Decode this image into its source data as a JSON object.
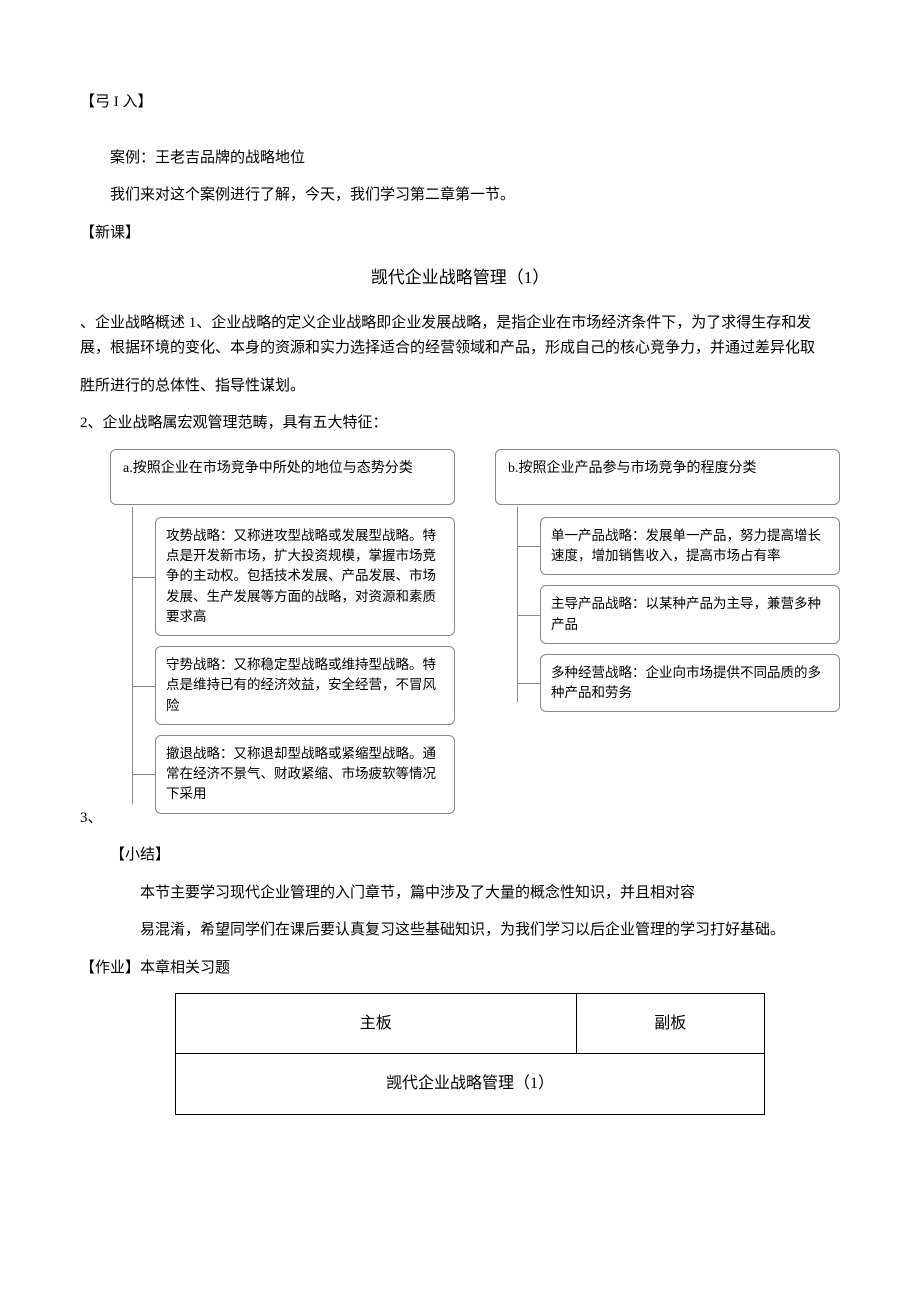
{
  "intro_marker": "【弓 I 入】",
  "case_line": "案例：王老吉品牌的战略地位",
  "case_desc": "我们来对这个案例进行了解，今天，我们学习第二章第一节。",
  "new_lesson_marker": "【新课】",
  "title": "觊代企业战略管理（1）",
  "para1": "、企业战略概述 1、企业战略的定义企业战略即企业发展战略，是指企业在市场经济条件下，为了求得生存和发展，根据环境的变化、本身的资源和实力选择适合的经营领域和产品，形成自己的核心竞争力，并通过差异化取",
  "para2": "胜所进行的总体性、指导性谋划。",
  "para3": "2、企业战略属宏观管理范畴，具有五大特征：",
  "diagram": {
    "left": {
      "header": "a.按照企业在市场竞争中所处的地位与态势分类",
      "items": [
        "攻势战略：又称进攻型战略或发展型战略。特点是开发新市场，扩大投资规模，掌握市场竞争的主动权。包括技术发展、产品发展、市场发展、生产发展等方面的战略，对资源和素质要求高",
        "守势战略：又称稳定型战略或维持型战略。特点是维持已有的经济效益，安全经营，不冒风险",
        "撤退战略：又称退却型战略或紧缩型战略。通常在经济不景气、财政紧缩、市场疲软等情况下采用"
      ]
    },
    "right": {
      "header": "b.按照企业产品参与市场竞争的程度分类",
      "items": [
        "单一产品战略：发展单一产品，努力提高增长速度，增加销售收入，提高市场占有率",
        "主导产品战略：以某种产品为主导，兼营多种产品",
        "多种经营战略：企业向市场提供不同品质的多种产品和劳务"
      ]
    }
  },
  "num3": "3、",
  "summary_marker": "【小结】",
  "summary_p1": "本节主要学习现代企业管理的入门章节，篇中涉及了大量的概念性知识，并且相对容",
  "summary_p2": "易混淆，希望同学们在课后要认真复习这些基础知识，为我们学习以后企业管理的学习打好基础。",
  "homework": "【作业】本章相关习题",
  "table": {
    "h1": "主板",
    "h2": "副板",
    "r2": "觊代企业战略管理（1）"
  }
}
